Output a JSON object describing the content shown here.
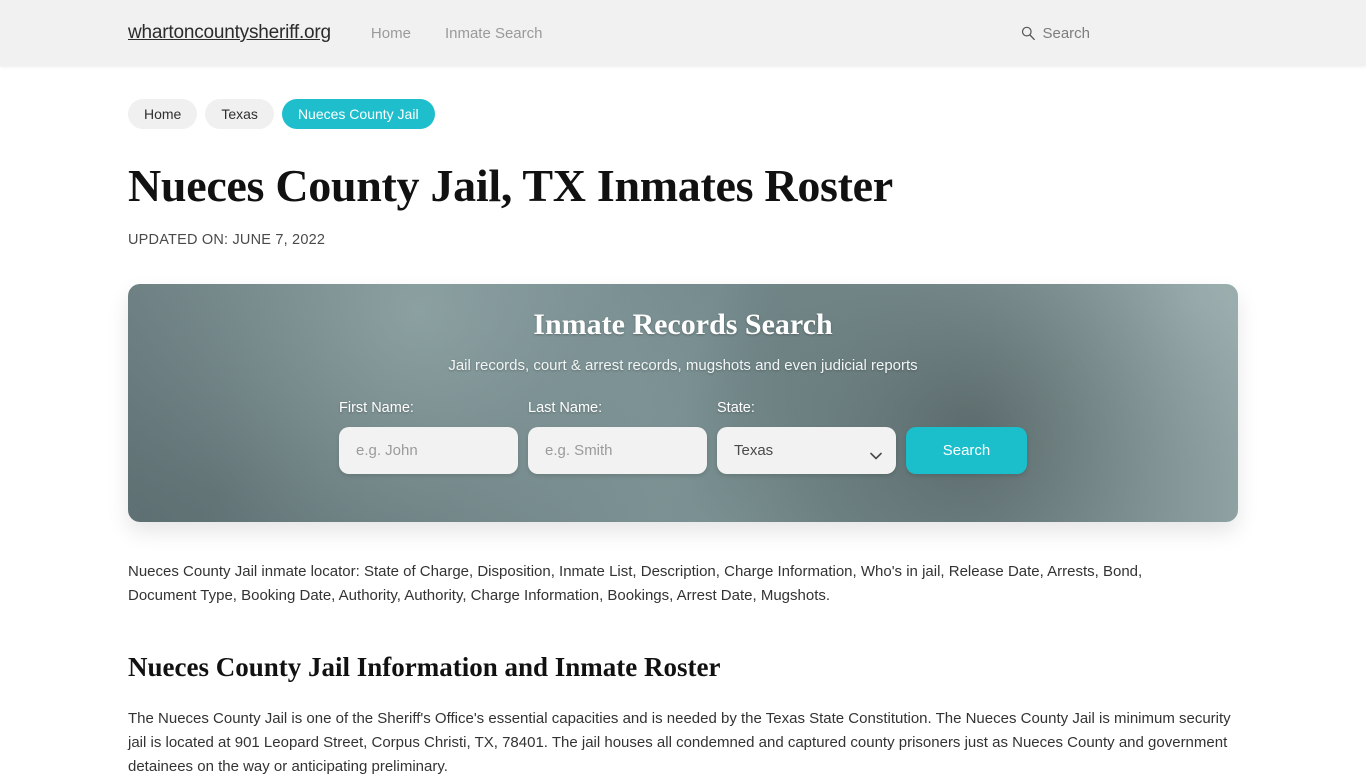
{
  "header": {
    "brand": "whartoncountysheriff.org",
    "nav": [
      {
        "label": "Home"
      },
      {
        "label": "Inmate Search"
      }
    ],
    "search": {
      "icon": "search-icon",
      "label": "Search"
    }
  },
  "breadcrumb": [
    {
      "label": "Home",
      "active": false
    },
    {
      "label": "Texas",
      "active": false
    },
    {
      "label": "Nueces County Jail",
      "active": true
    }
  ],
  "main": {
    "title": "Nueces County Jail, TX Inmates Roster",
    "updated_on": "UPDATED ON: JUNE 7, 2022",
    "intro_paragraph": "Nueces County Jail inmate locator: State of Charge, Disposition, Inmate List, Description, Charge Information, Who's in jail, Release Date, Arrests, Bond, Document Type, Booking Date, Authority, Authority, Charge Information, Bookings, Arrest Date, Mugshots.",
    "section_heading": "Nueces County Jail Information and Inmate Roster",
    "body_paragraph": "The Nueces County Jail is one of the Sheriff's Office's essential capacities and is needed by the Texas State Constitution. The Nueces County Jail is minimum security jail is located at 901 Leopard Street, Corpus Christi, TX, 78401. The jail houses all condemned and captured county prisoners just as Nueces County and government detainees on the way or anticipating preliminary."
  },
  "hero": {
    "title": "Inmate Records Search",
    "subtitle": "Jail records, court & arrest records, mugshots and even judicial reports",
    "first_name": {
      "label": "First Name:",
      "placeholder": "e.g. John",
      "value": ""
    },
    "last_name": {
      "label": "Last Name:",
      "placeholder": "e.g. Smith",
      "value": ""
    },
    "state": {
      "label": "State:",
      "selected": "Texas",
      "options": [
        "Texas"
      ]
    },
    "search_button": "Search"
  },
  "colors": {
    "accent_teal": "#1bbfcc",
    "breadcrumb_active": "#1fbecd",
    "header_bg": "#f1f1f1",
    "hero_bg": "#76898c"
  }
}
